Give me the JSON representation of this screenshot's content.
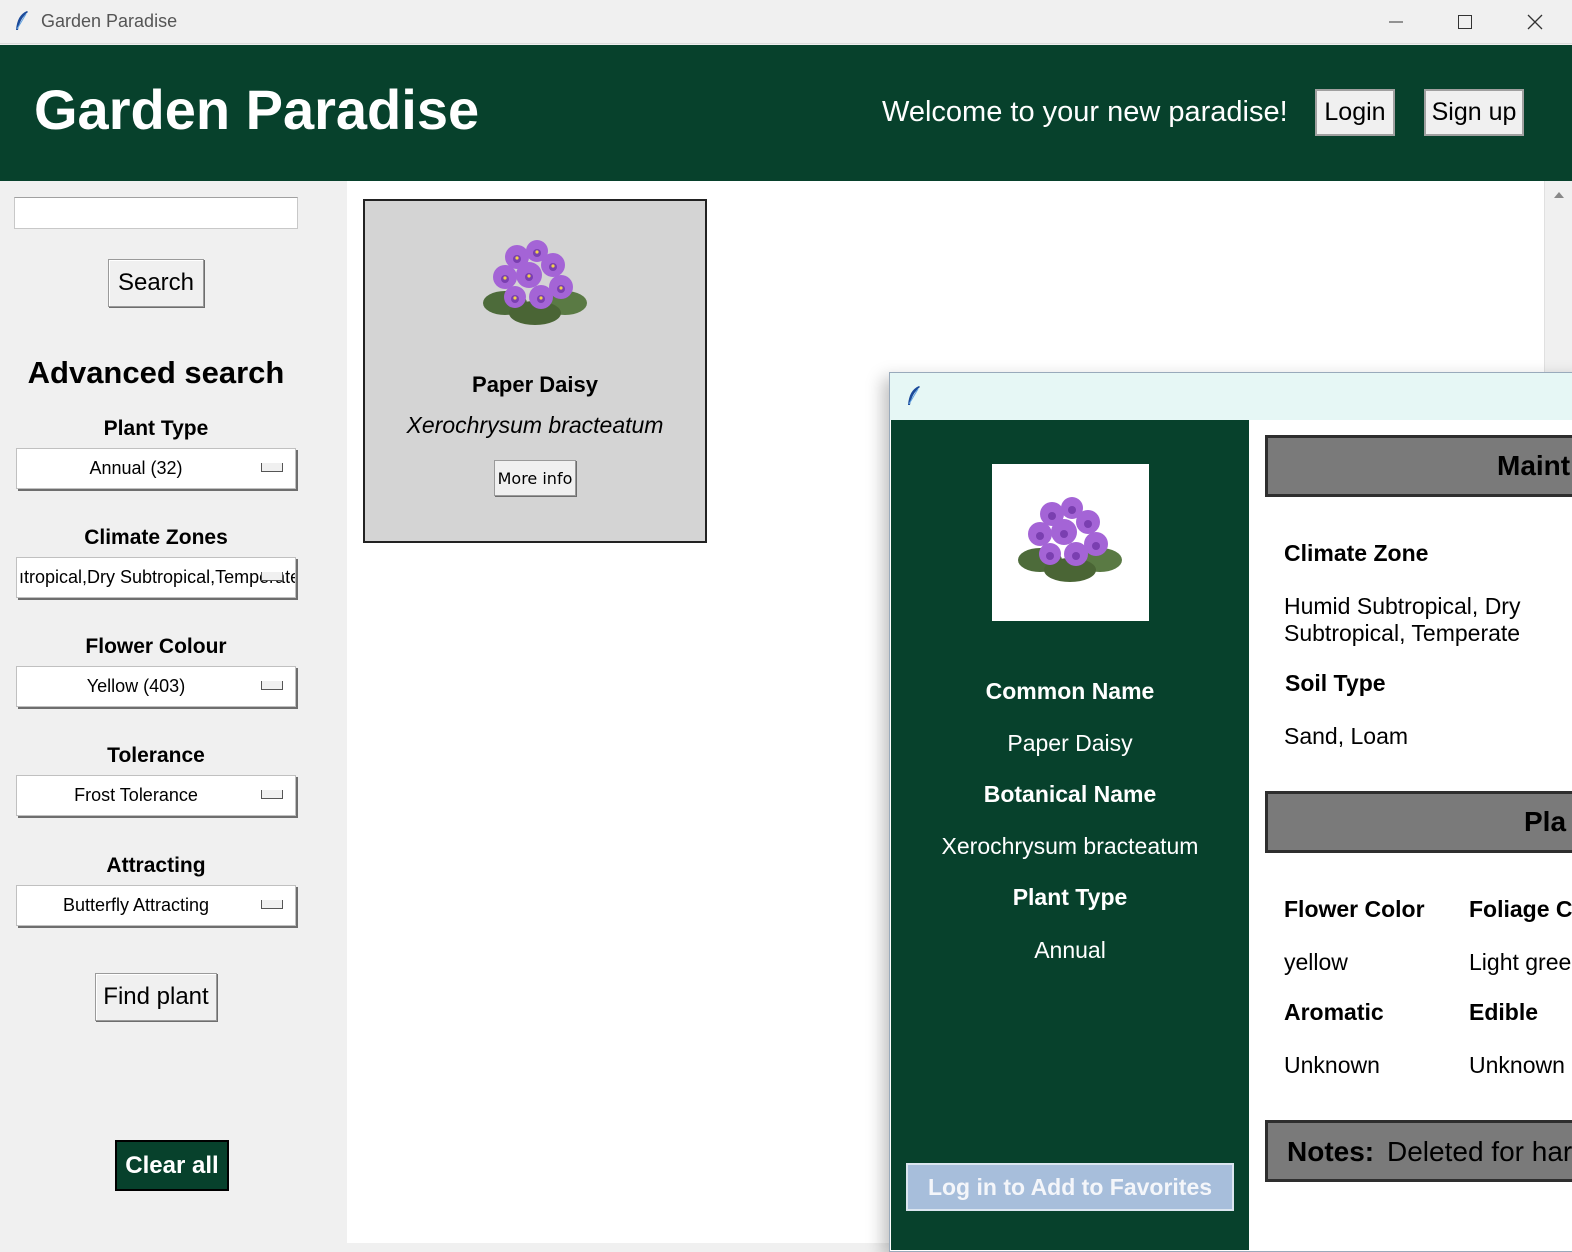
{
  "window": {
    "title": "Garden Paradise"
  },
  "header": {
    "title": "Garden Paradise",
    "welcome": "Welcome to your new paradise!",
    "login_label": "Login",
    "signup_label": "Sign up"
  },
  "sidebar": {
    "search_value": "",
    "search_label": "Search",
    "advanced_title": "Advanced search",
    "filters": [
      {
        "label": "Plant Type",
        "value": "Annual (32)"
      },
      {
        "label": "Climate Zones",
        "value": "ıtropical,Dry Subtropical,Temperate"
      },
      {
        "label": "Flower Colour",
        "value": "Yellow (403)"
      },
      {
        "label": "Tolerance",
        "value": "Frost Tolerance"
      },
      {
        "label": "Attracting",
        "value": "Butterfly Attracting"
      }
    ],
    "find_label": "Find plant",
    "clear_label": "Clear all"
  },
  "results": [
    {
      "common_name": "Paper Daisy",
      "botanical_name": "Xerochrysum bracteatum",
      "more_label": "More info"
    }
  ],
  "detail": {
    "common_name_label": "Common Name",
    "common_name": "Paper Daisy",
    "botanical_name_label": "Botanical Name",
    "botanical_name": "Xerochrysum bracteatum",
    "plant_type_label": "Plant Type",
    "plant_type": "Annual",
    "favorites_label": "Log in to Add to Favorites",
    "maintenance_section": "Maint",
    "climate_zone_label": "Climate Zone",
    "climate_zone_line1": "Humid Subtropical, Dry",
    "climate_zone_line2": "Subtropical, Temperate",
    "soil_type_label": "Soil Type",
    "soil_type": "Sand, Loam",
    "plant_section": "Pla",
    "flower_color_label": "Flower Color",
    "flower_color": "yellow",
    "foliage_label": "Foliage C",
    "foliage": "Light gree",
    "aromatic_label": "Aromatic",
    "aromatic": "Unknown",
    "edible_label": "Edible",
    "edible": "Unknown",
    "notes_label": "Notes:",
    "notes": "Deleted for har"
  },
  "colors": {
    "brand_green": "#07412c",
    "card_bg": "#d4d4d4",
    "section_grey": "#7a7a7a"
  }
}
